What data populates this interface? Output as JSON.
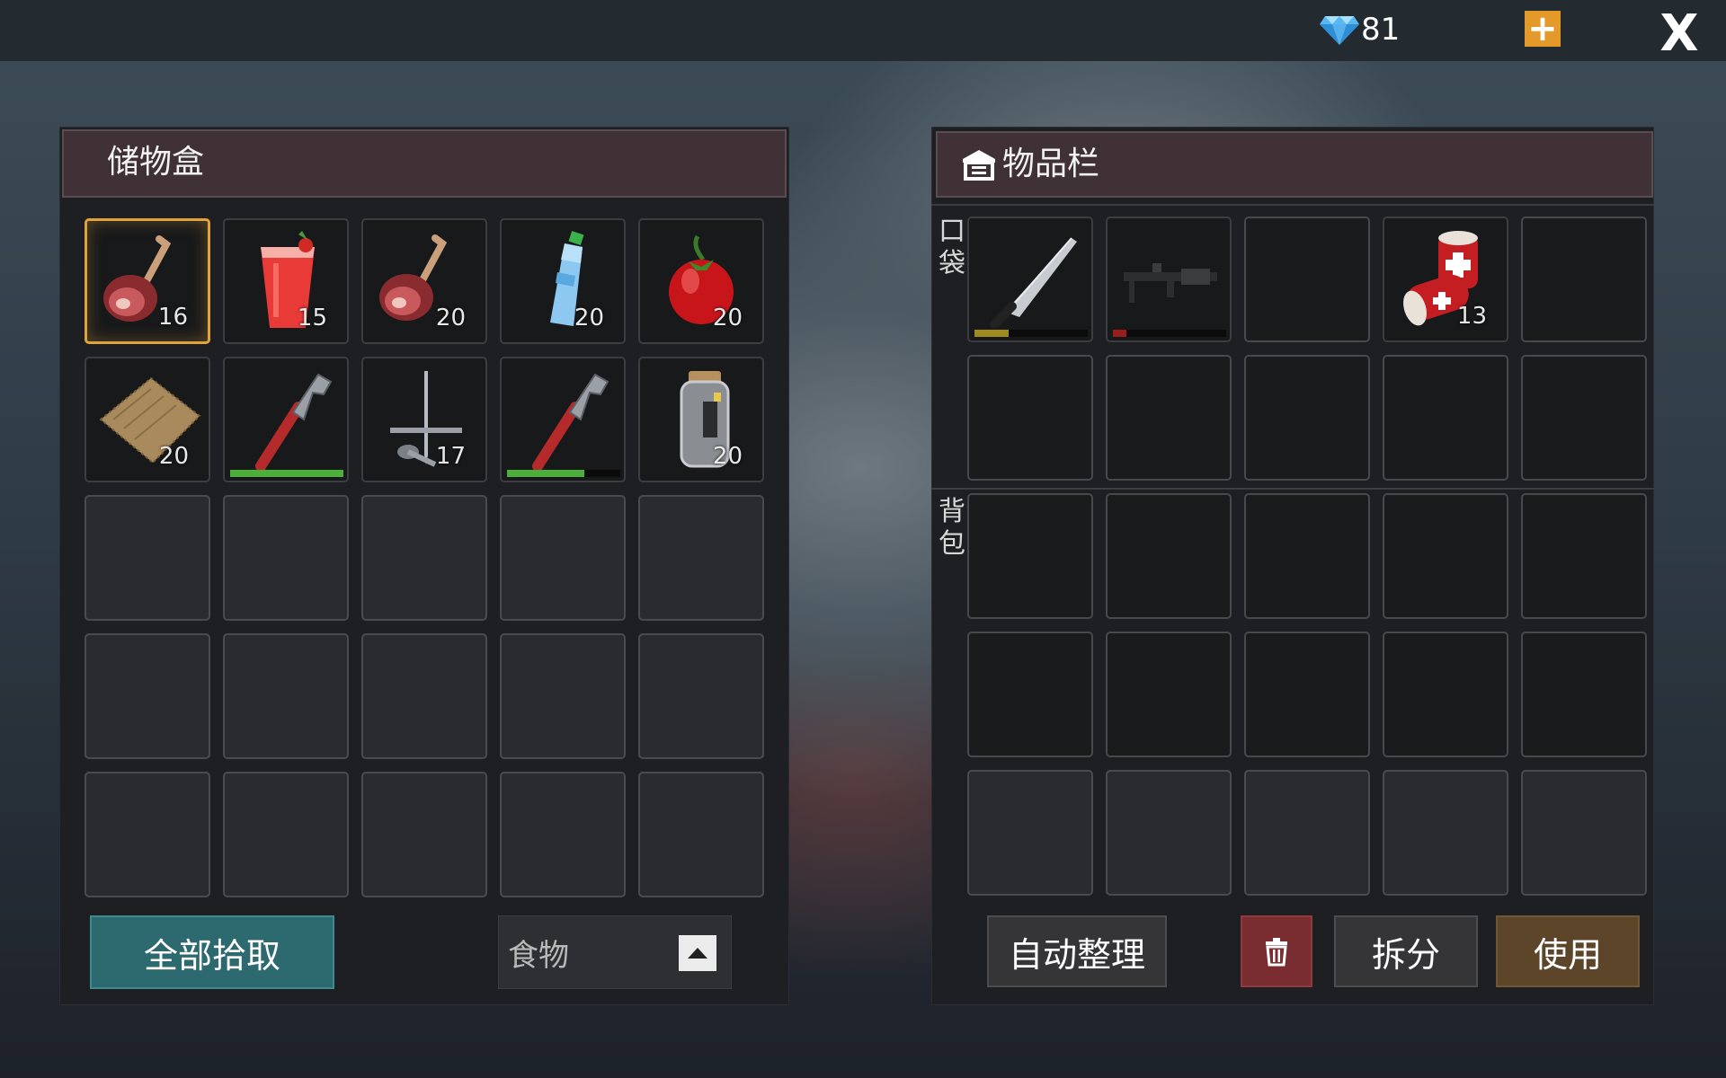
{
  "topbar": {
    "gems": "81",
    "gem_icon": "diamond-icon",
    "add_label": "+",
    "close_label": "X"
  },
  "storage": {
    "title": "储物盒",
    "slots": [
      {
        "icon": "ham-leg-icon",
        "count": "16",
        "selected": true
      },
      {
        "icon": "tomato-juice-icon",
        "count": "15"
      },
      {
        "icon": "ham-leg-icon",
        "count": "20"
      },
      {
        "icon": "water-bottle-icon",
        "count": "20"
      },
      {
        "icon": "tomato-icon",
        "count": "20"
      },
      {
        "icon": "burlap-cloth-icon",
        "count": "20"
      },
      {
        "icon": "pipe-wrench-icon",
        "durability": 1.0
      },
      {
        "icon": "nails-icon",
        "count": "17"
      },
      {
        "icon": "pipe-wrench-icon",
        "durability": 0.68
      },
      {
        "icon": "jar-icon",
        "count": "20"
      }
    ],
    "pickup_all_label": "全部拾取",
    "filter_value": "食物"
  },
  "inventory": {
    "title": "物品栏",
    "title_icon": "storage-box-icon",
    "pocket_label": "口袋",
    "backpack_label": "背包",
    "pocket_slots": [
      {
        "icon": "machete-icon",
        "durability": 0.3,
        "durability_color": "#a08a1e"
      },
      {
        "icon": "rifle-icon",
        "durability": 0.12,
        "durability_color": "#9a1c1c"
      },
      {},
      {
        "icon": "bandage-icon",
        "count": "13"
      },
      {}
    ],
    "sort_label": "自动整理",
    "trash_icon": "trash-icon",
    "split_label": "拆分",
    "use_label": "使用"
  },
  "colors": {
    "selected_border": "#e0a33a",
    "durability_green": "#4caf3a",
    "pickup_button": "#2c6a70",
    "trash_button": "#7a2d30",
    "use_button": "#5c4528"
  }
}
